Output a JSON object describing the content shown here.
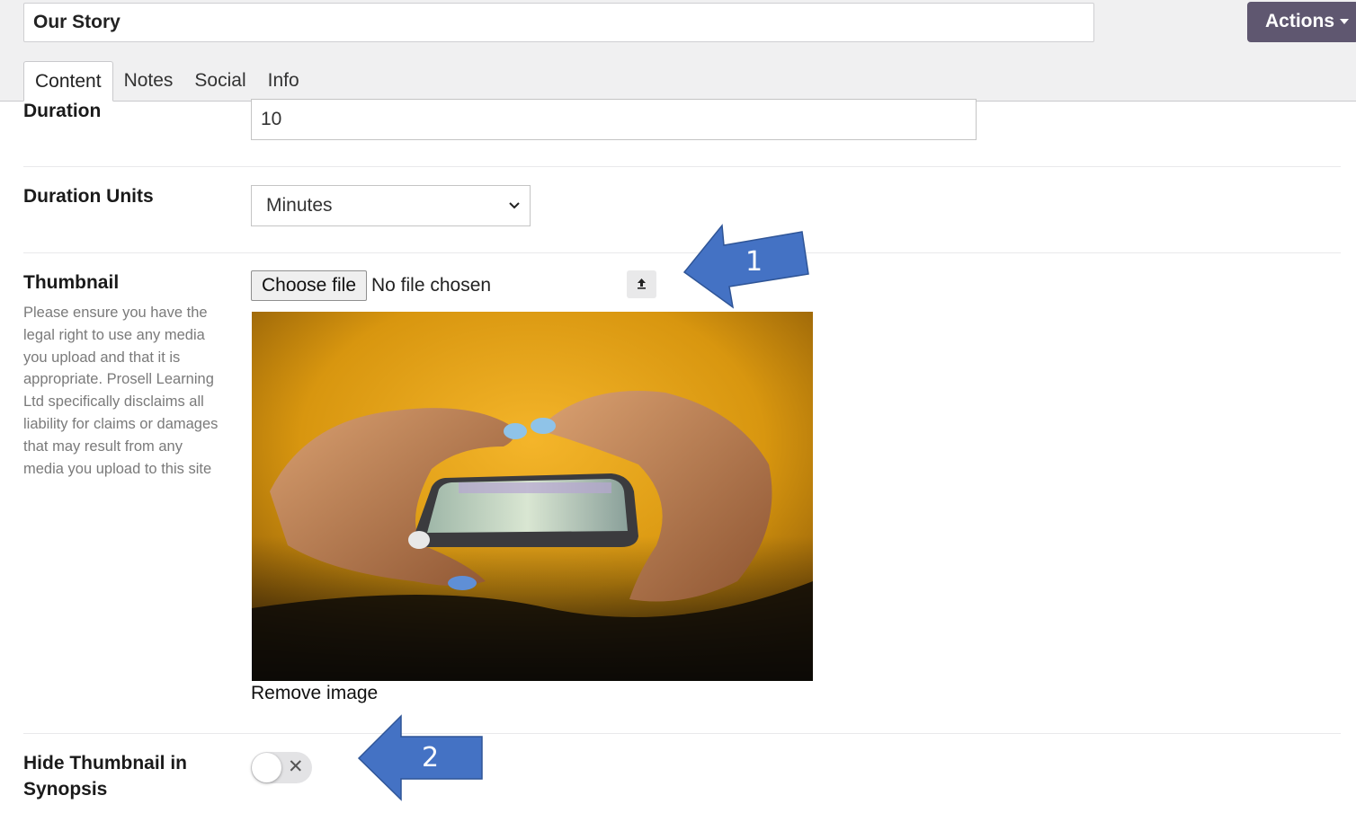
{
  "header": {
    "title_value": "Our Story",
    "actions_label": "Actions",
    "tabs": [
      {
        "label": "Content",
        "active": true
      },
      {
        "label": "Notes",
        "active": false
      },
      {
        "label": "Social",
        "active": false
      },
      {
        "label": "Info",
        "active": false
      }
    ]
  },
  "form": {
    "duration": {
      "label": "Duration",
      "value": "10"
    },
    "duration_units": {
      "label": "Duration Units",
      "selected": "Minutes"
    },
    "thumbnail": {
      "label": "Thumbnail",
      "help": "Please ensure you have the legal right to use any media you upload and that it is appropriate. Prosell Learning Ltd specifically disclaims all liability for claims or damages that may result from any media you upload to this site",
      "choose_file_label": "Choose file",
      "file_status": "No file chosen",
      "remove_label": "Remove image"
    },
    "hide_thumbnail": {
      "label_line1": "Hide Thumbnail in",
      "label_line2": "Synopsis",
      "on": false
    }
  },
  "annotations": {
    "arrow1_number": "1",
    "arrow2_number": "2",
    "arrow_color": "#4472c4"
  },
  "colors": {
    "actions_bg": "#5f5770",
    "header_bg": "#f0f0f1"
  },
  "icons": {
    "upload": "upload-icon",
    "dropdown": "chevron-down-icon",
    "toggle_off": "close-icon"
  }
}
